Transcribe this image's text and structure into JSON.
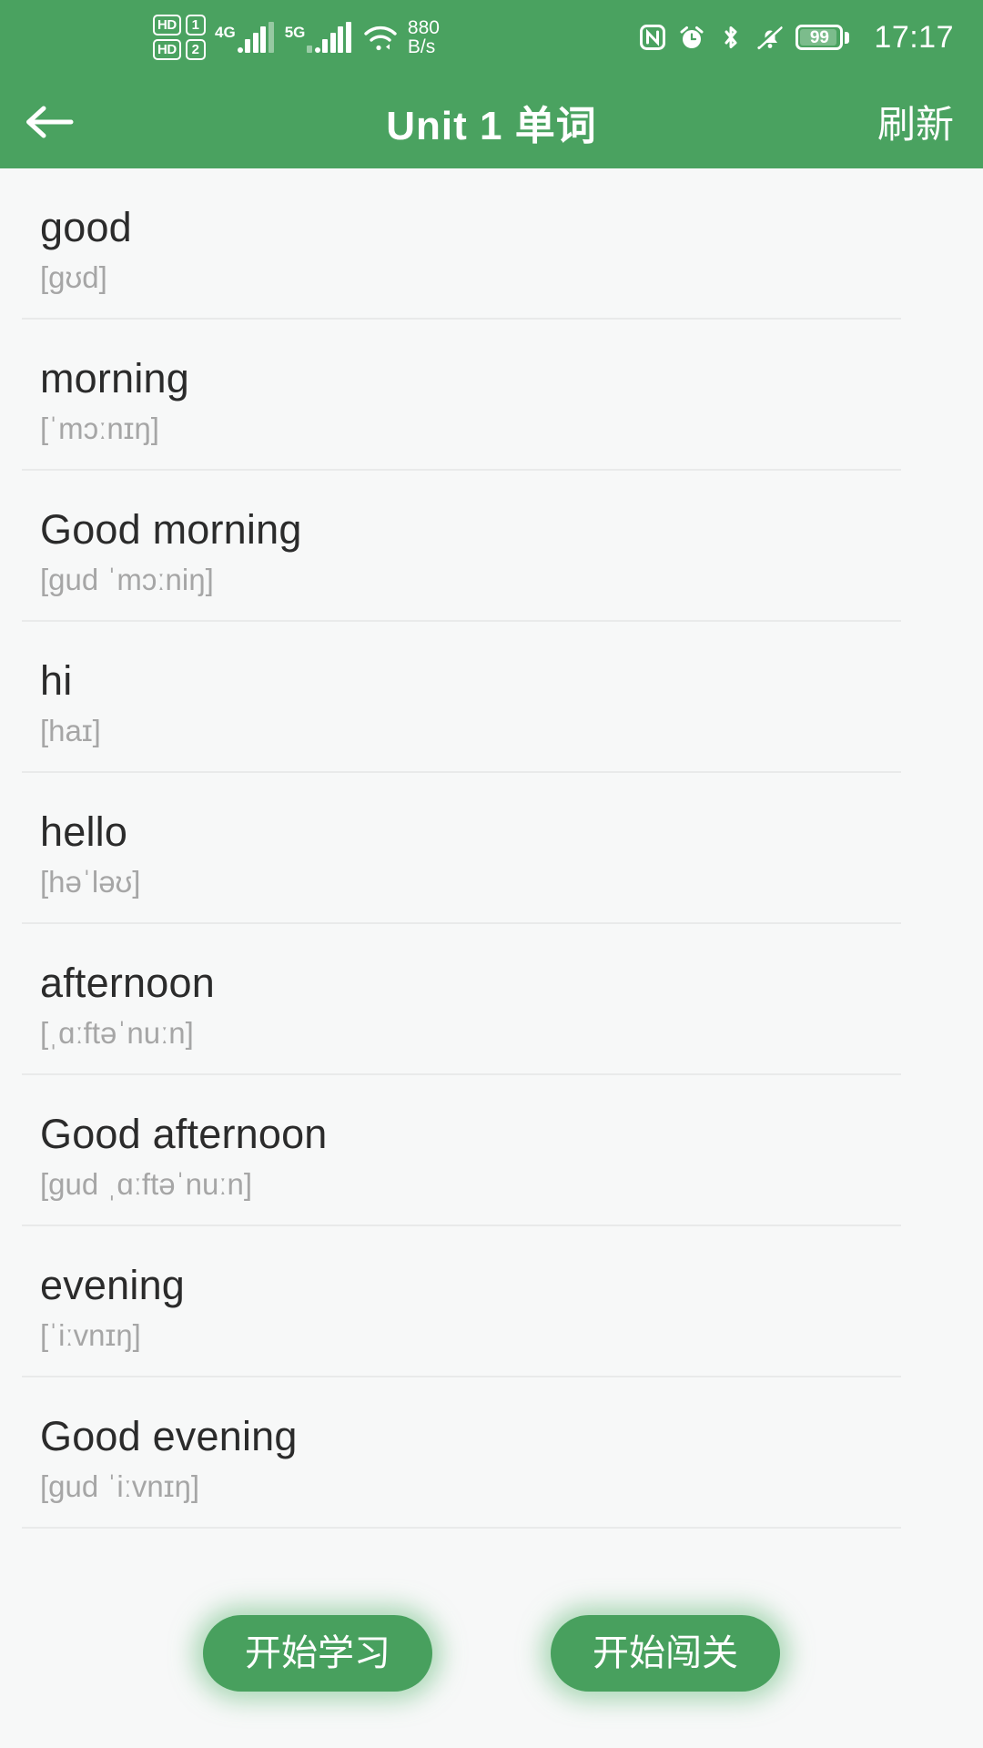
{
  "status_bar": {
    "hd_labels": [
      "HD",
      "HD"
    ],
    "sim_numbers": [
      "1",
      "2"
    ],
    "network_left": "4G",
    "network_right": "5G",
    "net_speed_value": "880",
    "net_speed_unit": "B/s",
    "icons": [
      "nfc-icon",
      "alarm-icon",
      "bluetooth-icon",
      "mute-bell-icon"
    ],
    "battery_percent": "99",
    "time": "17:17",
    "bg_color": "#4aa260"
  },
  "app_bar": {
    "back_icon": "arrow-left-icon",
    "title": "Unit 1 单词",
    "action_label": "刷新",
    "bg_color": "#4aa260"
  },
  "word_list": [
    {
      "word": "good",
      "phonetic": "[gʊd]"
    },
    {
      "word": "morning",
      "phonetic": "[ˈmɔːnɪŋ]"
    },
    {
      "word": "Good morning",
      "phonetic": "[gud ˈmɔːniŋ]"
    },
    {
      "word": "hi",
      "phonetic": "[haɪ]"
    },
    {
      "word": "hello",
      "phonetic": "[həˈləʊ]"
    },
    {
      "word": "afternoon",
      "phonetic": "[ˌɑːftəˈnuːn]"
    },
    {
      "word": "Good afternoon",
      "phonetic": "[gud ˌɑːftəˈnuːn]"
    },
    {
      "word": "evening",
      "phonetic": "[ˈiːvnɪŋ]"
    },
    {
      "word": "Good evening",
      "phonetic": "[gud ˈiːvnɪŋ]"
    }
  ],
  "floating_buttons": {
    "start_study_label": "开始学习",
    "start_challenge_label": "开始闯关",
    "color": "#48a05e"
  }
}
